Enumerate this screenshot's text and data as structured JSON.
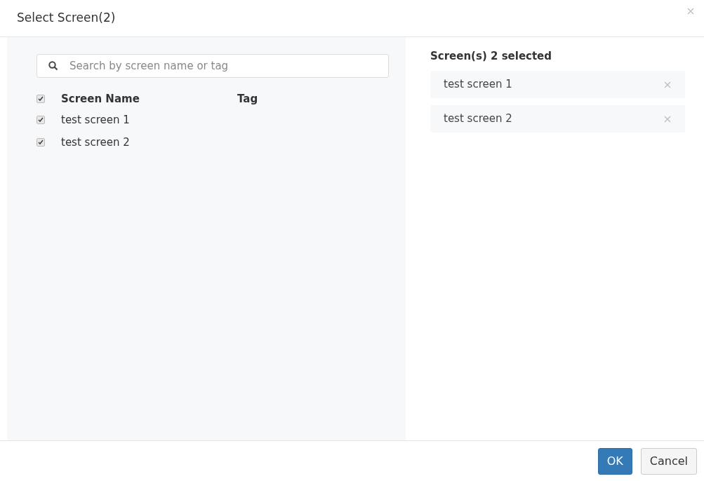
{
  "dialog": {
    "title": "Select Screen(2)"
  },
  "search": {
    "placeholder": "Search by screen name or tag"
  },
  "table": {
    "columns": [
      "Screen Name",
      "Tag"
    ],
    "select_all_checked": true,
    "rows": [
      {
        "name": "test screen 1",
        "checked": true
      },
      {
        "name": "test screen 2",
        "checked": true
      }
    ]
  },
  "selected_panel": {
    "heading": "Screen(s) 2 selected",
    "items": [
      "test screen 1",
      "test screen 2"
    ]
  },
  "buttons": [
    {
      "label": "OK",
      "kind": "primary"
    },
    {
      "label": "Cancel",
      "kind": "default"
    }
  ]
}
